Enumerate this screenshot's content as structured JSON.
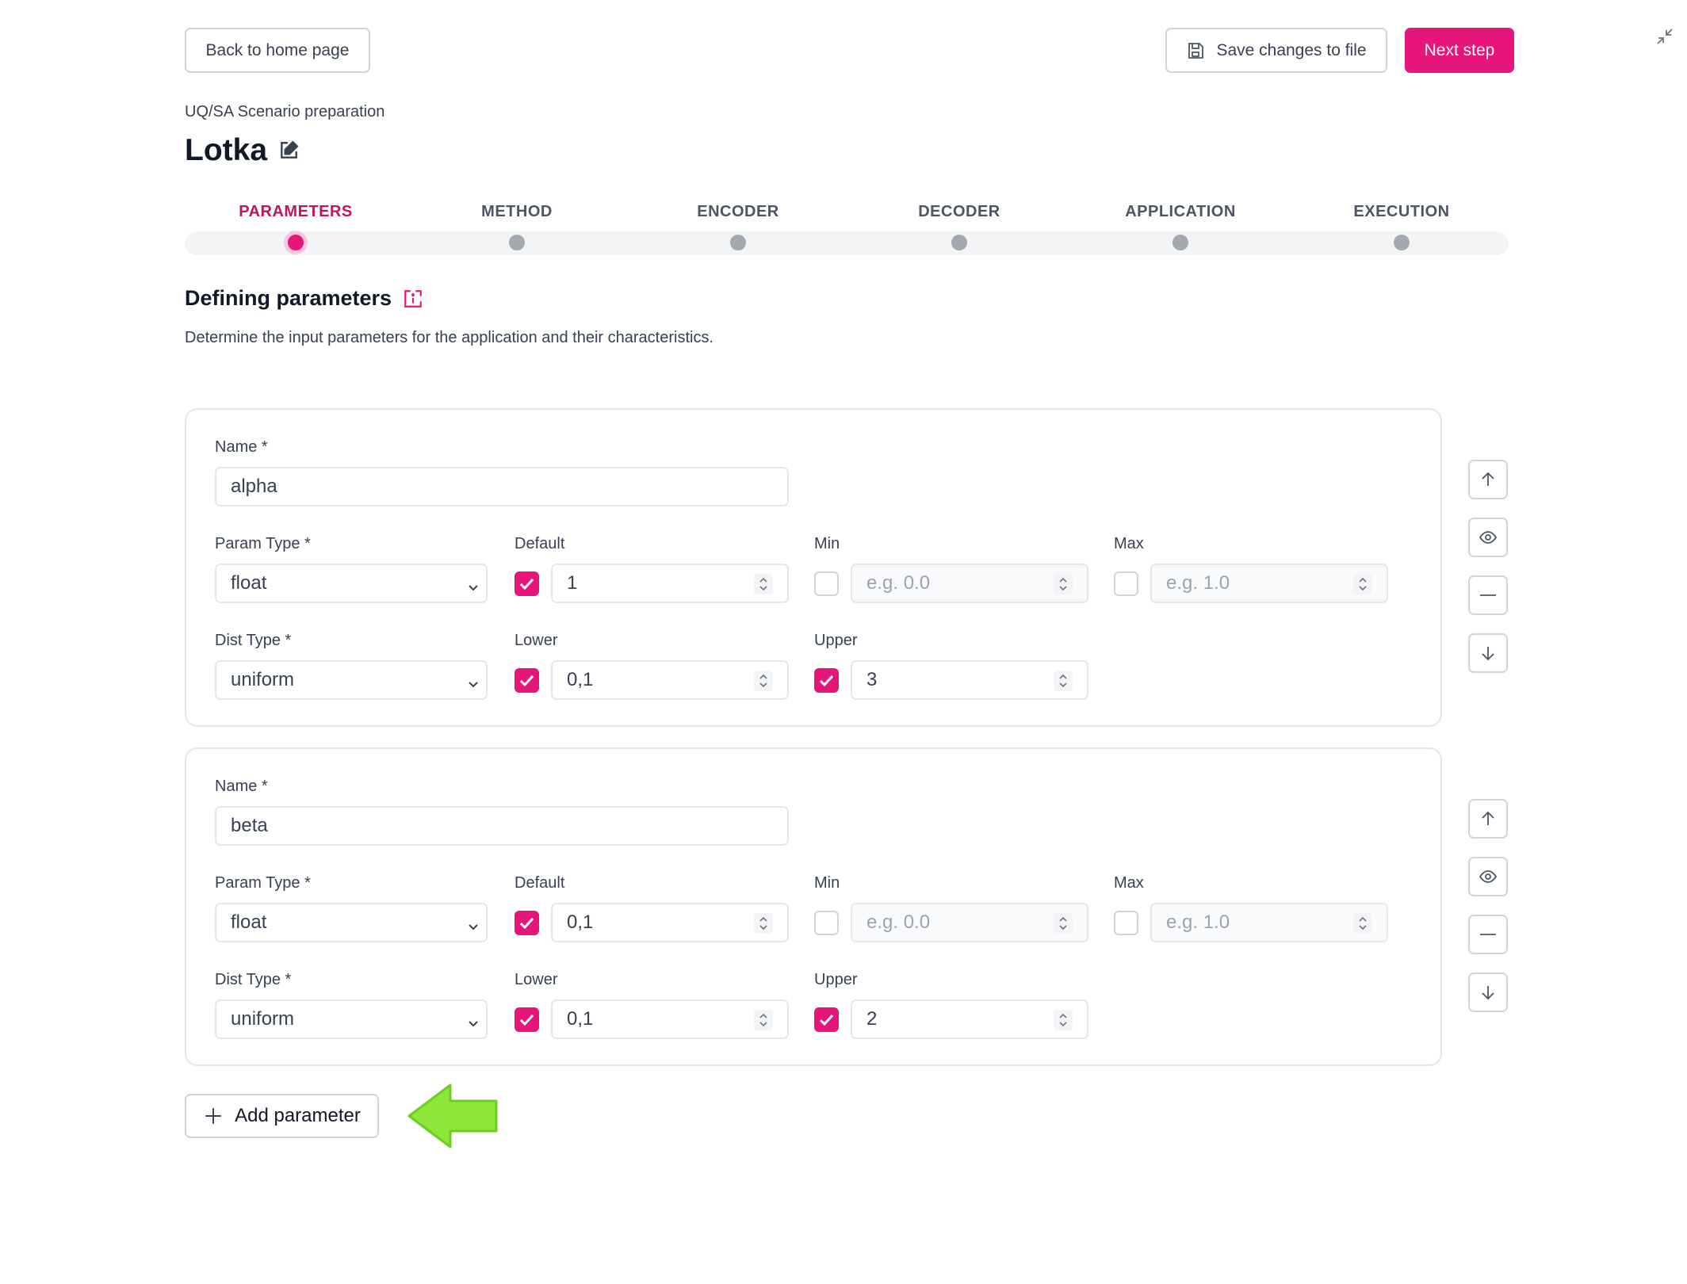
{
  "header": {
    "back_label": "Back to home page",
    "save_label": "Save changes to file",
    "next_label": "Next step",
    "accent_color": "#e6157a"
  },
  "breadcrumb": "UQ/SA Scenario preparation",
  "scenario_title": "Lotka",
  "steps": [
    {
      "label": "PARAMETERS",
      "active": true
    },
    {
      "label": "METHOD",
      "active": false
    },
    {
      "label": "ENCODER",
      "active": false
    },
    {
      "label": "DECODER",
      "active": false
    },
    {
      "label": "APPLICATION",
      "active": false
    },
    {
      "label": "EXECUTION",
      "active": false
    }
  ],
  "section": {
    "title": "Defining parameters",
    "description": "Determine the input parameters for the application and their characteristics."
  },
  "field_labels": {
    "name": "Name *",
    "param_type": "Param Type *",
    "default": "Default",
    "min": "Min",
    "max": "Max",
    "dist_type": "Dist Type *",
    "lower": "Lower",
    "upper": "Upper"
  },
  "parameters": [
    {
      "name": "alpha",
      "param_type": "float",
      "default": "1",
      "default_enabled": true,
      "min_placeholder": "e.g. 0.0",
      "min_enabled": false,
      "max_placeholder": "e.g. 1.0",
      "max_enabled": false,
      "dist_type": "uniform",
      "lower": "0,1",
      "lower_enabled": true,
      "upper": "3",
      "upper_enabled": true
    },
    {
      "name": "beta",
      "param_type": "float",
      "default": "0,1",
      "default_enabled": true,
      "min_placeholder": "e.g. 0.0",
      "min_enabled": false,
      "max_placeholder": "e.g. 1.0",
      "max_enabled": false,
      "dist_type": "uniform",
      "lower": "0,1",
      "lower_enabled": true,
      "upper": "2",
      "upper_enabled": true
    }
  ],
  "side_actions": [
    "arrow-up-icon",
    "eye-icon",
    "minus-icon",
    "arrow-down-icon"
  ],
  "add_parameter_label": "Add parameter"
}
